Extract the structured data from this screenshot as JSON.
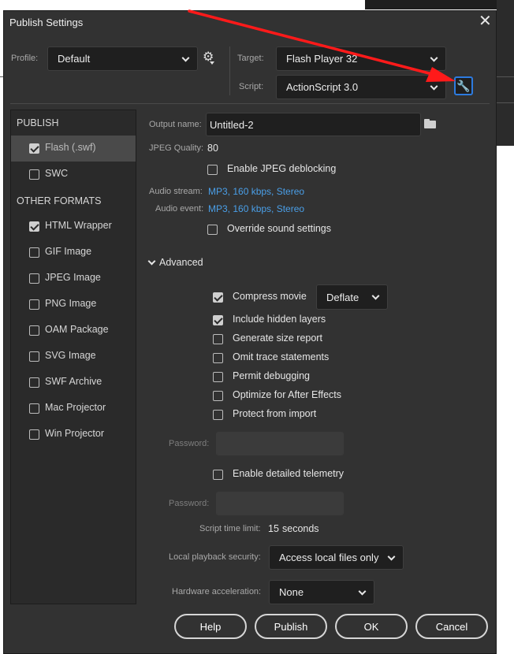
{
  "dialog": {
    "title": "Publish Settings",
    "close_label": "✕"
  },
  "profile": {
    "label": "Profile:",
    "value": "Default"
  },
  "target": {
    "label": "Target:",
    "value": "Flash Player 32"
  },
  "script": {
    "label": "Script:",
    "value": "ActionScript 3.0"
  },
  "sidebar": {
    "publish_heading": "PUBLISH",
    "other_heading": "OTHER FORMATS",
    "publish_items": [
      {
        "label": "Flash (.swf)",
        "checked": true,
        "selected": true
      },
      {
        "label": "SWC",
        "checked": false,
        "selected": false
      }
    ],
    "other_items": [
      {
        "label": "HTML Wrapper",
        "checked": true
      },
      {
        "label": "GIF Image",
        "checked": false
      },
      {
        "label": "JPEG Image",
        "checked": false
      },
      {
        "label": "PNG Image",
        "checked": false
      },
      {
        "label": "OAM Package",
        "checked": false
      },
      {
        "label": "SVG Image",
        "checked": false
      },
      {
        "label": "SWF Archive",
        "checked": false
      },
      {
        "label": "Mac Projector",
        "checked": false
      },
      {
        "label": "Win Projector",
        "checked": false
      }
    ]
  },
  "main": {
    "output_name_label": "Output name:",
    "output_name_value": "Untitled-2",
    "jpeg_quality_label": "JPEG Quality:",
    "jpeg_quality_value": "80",
    "enable_jpeg_deblocking": "Enable JPEG deblocking",
    "audio_stream_label": "Audio stream:",
    "audio_stream_value": "MP3, 160 kbps, Stereo",
    "audio_event_label": "Audio event:",
    "audio_event_value": "MP3, 160 kbps, Stereo",
    "override_sound": "Override sound settings",
    "advanced_label": "Advanced",
    "compress_movie": "Compress movie",
    "compress_value": "Deflate",
    "include_hidden_layers": "Include hidden layers",
    "generate_size_report": "Generate size report",
    "omit_trace": "Omit trace statements",
    "permit_debugging": "Permit debugging",
    "optimize_ae": "Optimize for After Effects",
    "protect_import": "Protect from import",
    "password_label_1": "Password:",
    "enable_telemetry": "Enable detailed telemetry",
    "password_label_2": "Password:",
    "script_time_limit_label": "Script time limit:",
    "script_time_limit_value": "15",
    "script_time_limit_unit": "seconds",
    "local_playback_label": "Local playback security:",
    "local_playback_value": "Access local files only",
    "hw_accel_label": "Hardware acceleration:",
    "hw_accel_value": "None"
  },
  "checks": {
    "compress_movie": true,
    "include_hidden_layers": true,
    "generate_size_report": false,
    "omit_trace": false,
    "permit_debugging": false,
    "optimize_ae": false,
    "protect_import": false,
    "enable_telemetry": false,
    "enable_jpeg_deblocking": false,
    "override_sound": false
  },
  "buttons": {
    "help": "Help",
    "publish": "Publish",
    "ok": "OK",
    "cancel": "Cancel"
  },
  "colors": {
    "accent": "#2d7be0",
    "link": "#4a9fe8",
    "annotation_arrow": "#ff1a1a"
  },
  "icons": {
    "gear": "gear-icon",
    "wrench": "wrench-icon",
    "folder": "folder-icon"
  }
}
